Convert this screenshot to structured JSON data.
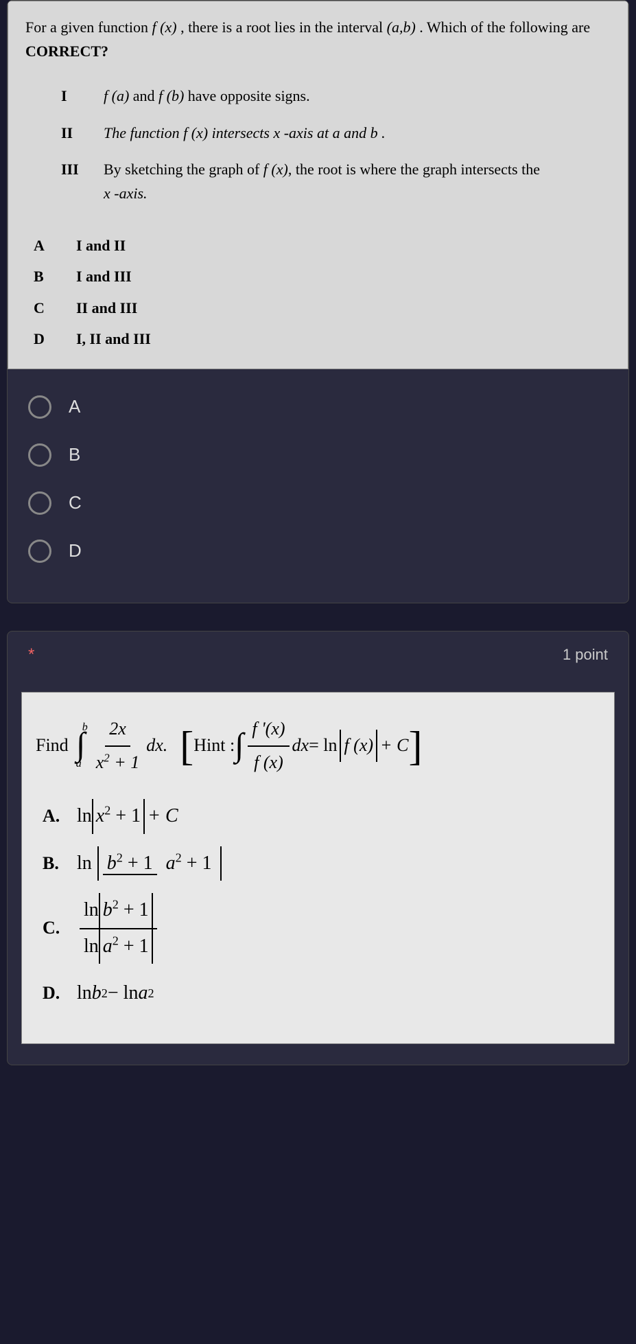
{
  "q1": {
    "intro_part1": "For a given function ",
    "intro_fx": "f (x)",
    "intro_part2": ", there is a root lies in the interval ",
    "intro_ab": "(a,b)",
    "intro_part3": ". Which of the following are ",
    "intro_correct": "CORRECT?",
    "statements": [
      {
        "num": "I",
        "text_pre": "f (a)",
        "text_mid": " and ",
        "text_fb": "f (b)",
        "text_post": " have opposite signs."
      },
      {
        "num": "II",
        "text": "The function f (x)  intersects  x -axis at  a and  b ."
      },
      {
        "num": "III",
        "text_pre": "By sketching the graph of ",
        "text_fx": "f (x)",
        "text_post": ", the root is where the graph intersects the",
        "text_line2": "x -axis."
      }
    ],
    "answers": [
      {
        "letter": "A",
        "text": "I and II"
      },
      {
        "letter": "B",
        "text": "I and III"
      },
      {
        "letter": "C",
        "text": "II and III"
      },
      {
        "letter": "D",
        "text": "I, II and III"
      }
    ],
    "options": [
      "A",
      "B",
      "C",
      "D"
    ]
  },
  "q2": {
    "required": "*",
    "points": "1 point",
    "find": "Find",
    "int_upper": "b",
    "int_lower": "a",
    "frac1_num": "2x",
    "frac1_den_pre": "x",
    "frac1_den_sup": "2",
    "frac1_den_post": " + 1",
    "dx": "dx.",
    "hint": "Hint :",
    "frac2_num": "f '(x)",
    "frac2_den": "f (x)",
    "dx2": "dx",
    "eq": " = ln",
    "abs_fx": "f (x)",
    "plusC": "+ C",
    "answers": {
      "A": {
        "letter": "A.",
        "pre": "ln",
        "abs_pre": "x",
        "abs_sup": "2",
        "abs_post": " + 1",
        "post": "+ C"
      },
      "B": {
        "letter": "B.",
        "pre": "ln",
        "num_pre": "b",
        "num_sup": "2",
        "num_post": " + 1",
        "den_pre": "a",
        "den_sup": "2",
        "den_post": " + 1"
      },
      "C": {
        "letter": "C.",
        "num_pre": "ln",
        "num_abs_pre": "b",
        "num_abs_sup": "2",
        "num_abs_post": " + 1",
        "den_pre": "ln",
        "den_abs_pre": "a",
        "den_abs_sup": "2",
        "den_abs_post": " + 1"
      },
      "D": {
        "letter": "D.",
        "text_pre": "ln ",
        "b": "b",
        "sup2a": "2",
        "minus": " − ln ",
        "a": "a",
        "sup2b": "2"
      }
    }
  }
}
